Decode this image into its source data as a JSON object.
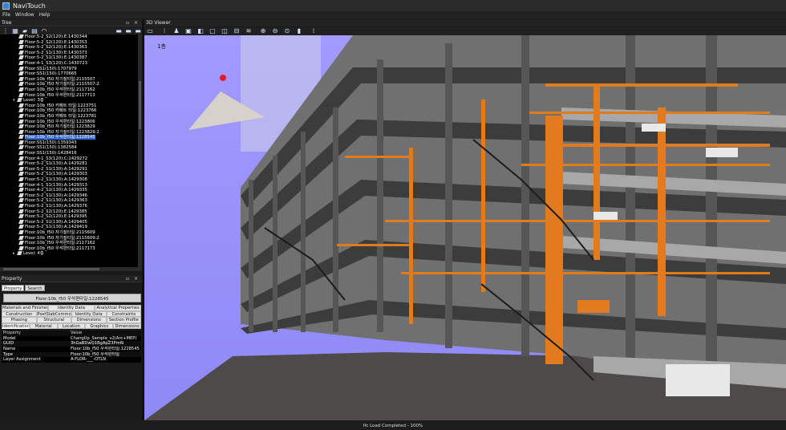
{
  "app": {
    "title": "NaviTouch"
  },
  "menu": [
    "File",
    "Window",
    "Help"
  ],
  "tree_panel": {
    "title": "Tree",
    "controls": "▫ ×",
    "items": [
      {
        "label": "Floor:5-2_S2(120):E:1430344",
        "level": 3,
        "icon": "floor-icon"
      },
      {
        "label": "Floor:5-2_S2(120):E:1430353",
        "level": 3,
        "icon": "floor-icon"
      },
      {
        "label": "Floor:5-2_S2(120):E:1430363",
        "level": 3,
        "icon": "floor-icon"
      },
      {
        "label": "Floor:5-2_S1(130):E:1430373",
        "level": 3,
        "icon": "floor-icon"
      },
      {
        "label": "Floor:5-2_S1(130):E:1430387",
        "level": 3,
        "icon": "floor-icon"
      },
      {
        "label": "Floor:4-1_S3(120):C:1430723",
        "level": 3,
        "icon": "floor-icon"
      },
      {
        "label": "Floor:SS1(150):1707979",
        "level": 3,
        "icon": "floor-icon"
      },
      {
        "label": "Floor:SS1(150):1770665",
        "level": 3,
        "icon": "floor-icon"
      },
      {
        "label": "Floor:10b_f50 자기질타일:2115507",
        "level": 3,
        "icon": "floor-icon"
      },
      {
        "label": "Floor:10b_f50 자기질타일:2115507:2",
        "level": 3,
        "icon": "floor-icon"
      },
      {
        "label": "Floor:10b_f50 우석편타일:2117162",
        "level": 3,
        "icon": "floor-icon"
      },
      {
        "label": "Floor:10b_f50 우석편타일:2117713",
        "level": 3,
        "icon": "floor-icon"
      },
      {
        "label": "Level: 3층",
        "level": 1,
        "icon": "level-icon",
        "expanded": true
      },
      {
        "label": "Floor:10b_f50 카페트 타일:1223751",
        "level": 3,
        "icon": "floor-icon"
      },
      {
        "label": "Floor:10b_f50 카페트 타일:1223766",
        "level": 3,
        "icon": "floor-icon"
      },
      {
        "label": "Floor:10b_f50 카페트 타일:1223781",
        "level": 3,
        "icon": "floor-icon"
      },
      {
        "label": "Floor:10b_f50 우석편타일:1223806",
        "level": 3,
        "icon": "floor-icon"
      },
      {
        "label": "Floor:10b_f50 자기질타일:1223829",
        "level": 3,
        "icon": "floor-icon"
      },
      {
        "label": "Floor:10b_f50 자기질타일:1223829:2",
        "level": 3,
        "icon": "floor-icon"
      },
      {
        "label": "Floor:10b_f50 우석편타일:1228545",
        "level": 3,
        "icon": "floor-icon",
        "selected": true
      },
      {
        "label": "Floor:SS1(150):1359343",
        "level": 3,
        "icon": "floor-icon"
      },
      {
        "label": "Floor:SS1(150):1382584",
        "level": 3,
        "icon": "floor-icon"
      },
      {
        "label": "Floor:SS1(150):1428416",
        "level": 3,
        "icon": "floor-icon"
      },
      {
        "label": "Floor:4-1_S3(120):C:1429272",
        "level": 3,
        "icon": "floor-icon"
      },
      {
        "label": "Floor:5-2_S1(130):A:1429281",
        "level": 3,
        "icon": "floor-icon"
      },
      {
        "label": "Floor:5-2_S1(130):A:1429291",
        "level": 3,
        "icon": "floor-icon"
      },
      {
        "label": "Floor:5-2_S1(130):A:1429303",
        "level": 3,
        "icon": "floor-icon"
      },
      {
        "label": "Floor:5-2_S1(130):A:1429308",
        "level": 3,
        "icon": "floor-icon"
      },
      {
        "label": "Floor:4-1_S1(130):A:1429313",
        "level": 3,
        "icon": "floor-icon"
      },
      {
        "label": "Floor:4-2_S1(130):A:1429335",
        "level": 3,
        "icon": "floor-icon"
      },
      {
        "label": "Floor:5-2_S1(130):A:1429346",
        "level": 3,
        "icon": "floor-icon"
      },
      {
        "label": "Floor:5-2_S1(130):A:1429363",
        "level": 3,
        "icon": "floor-icon"
      },
      {
        "label": "Floor:5-2_S1(130):A:1429376",
        "level": 3,
        "icon": "floor-icon"
      },
      {
        "label": "Floor:5-2_S2(120):E:1429385",
        "level": 3,
        "icon": "floor-icon"
      },
      {
        "label": "Floor:5-2_S2(120):E:1429395",
        "level": 3,
        "icon": "floor-icon"
      },
      {
        "label": "Floor:5-2_S1(130):A:1429405",
        "level": 3,
        "icon": "floor-icon"
      },
      {
        "label": "Floor:5-2_S1(130):A:1429419",
        "level": 3,
        "icon": "floor-icon"
      },
      {
        "label": "Floor:10b_f50 자기질타일:2115609",
        "level": 3,
        "icon": "floor-icon"
      },
      {
        "label": "Floor:10b_f50 자기질타일:2115609:2",
        "level": 3,
        "icon": "floor-icon"
      },
      {
        "label": "Floor:10b_f50 우석편타일:2117162",
        "level": 3,
        "icon": "floor-icon"
      },
      {
        "label": "Floor:10b_f50 우석편타일:2117173",
        "level": 3,
        "icon": "floor-icon"
      },
      {
        "label": "Level: 4층",
        "level": 1,
        "icon": "level-icon",
        "expanded": false
      }
    ]
  },
  "property_panel": {
    "title": "Property",
    "controls": "▫ ×",
    "tabs": [
      "Property",
      "Search"
    ],
    "selected_element": "Floor:10b_f50 우석편타일:1228545",
    "categories": [
      [
        "Materials and Finishes",
        "Identity Data",
        "Analytical Properties"
      ],
      [
        "Construction",
        "PsetSlabCommon",
        "Identity Data",
        "Constraints"
      ],
      [
        "Phasing",
        "Structural",
        "Dimensions",
        "Section Profile"
      ],
      [
        "Identification",
        "Material",
        "Location",
        "Graphics",
        "Dimensions"
      ]
    ],
    "active_category": "Identification",
    "table_header": {
      "key": "Property",
      "value": "Value"
    },
    "rows": [
      {
        "key": "Model",
        "value": "ChangUp_Sample_v2(Arc+MEP)"
      },
      {
        "key": "GUID",
        "value": "3hGaBDwQ1BgApZ3Pm6i"
      },
      {
        "key": "Name",
        "value": "Floor:10b_f50 우석편타일:1228545"
      },
      {
        "key": "Type",
        "value": "Floor:10b_f50 우석편타일"
      },
      {
        "key": "Layer Assignment",
        "value": "A-FLOR-___-OTLN"
      }
    ]
  },
  "viewer": {
    "title": "3D Viewer",
    "floor_label": "1층",
    "toolbar_icons": [
      "open-icon",
      "grid-icon",
      "walk-icon",
      "cube-icon",
      "section-icon",
      "box-icon",
      "camera-icon",
      "measure-icon",
      "layers-icon",
      "zoom-in-icon",
      "zoom-out-icon",
      "fit-icon",
      "battery-icon",
      "dots-icon"
    ]
  },
  "status": {
    "text": "Ifc Load Completed - 100%"
  },
  "colors": {
    "viewer_bg": "#9b95ff",
    "structure": "#5a5a5a",
    "pipe": "#e07b1f",
    "selection": "#3468c8"
  }
}
